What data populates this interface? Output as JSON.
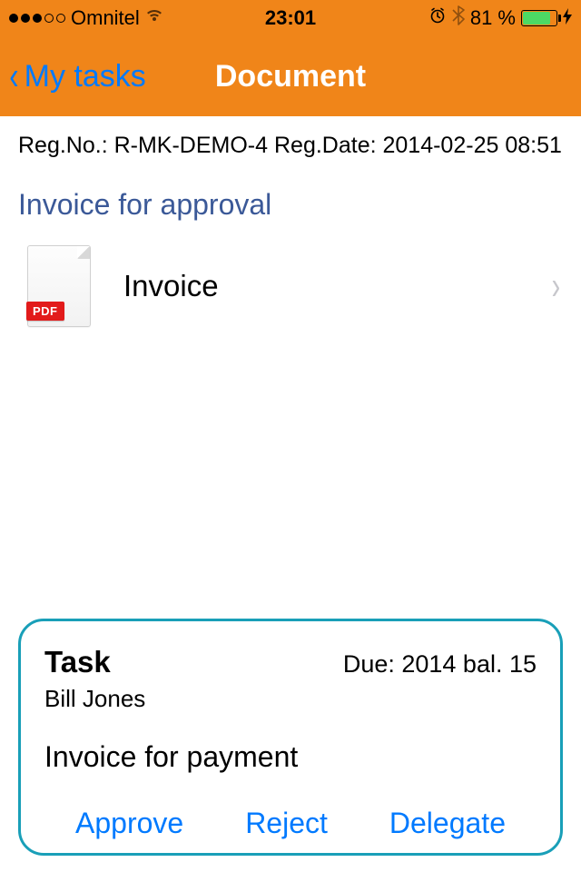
{
  "status": {
    "carrier": "Omnitel",
    "time": "23:01",
    "battery_pct": "81 %",
    "signal_filled": 3,
    "signal_total": 5
  },
  "nav": {
    "back_label": "My tasks",
    "title": "Document"
  },
  "document": {
    "reg_line": "Reg.No.: R-MK-DEMO-4 Reg.Date: 2014-02-25 08:51",
    "section_title": "Invoice for approval",
    "file": {
      "name": "Invoice",
      "badge": "PDF"
    }
  },
  "task": {
    "heading": "Task",
    "due": "Due: 2014 bal. 15",
    "person": "Bill Jones",
    "description": "Invoice for payment",
    "actions": {
      "approve": "Approve",
      "reject": "Reject",
      "delegate": "Delegate"
    }
  }
}
